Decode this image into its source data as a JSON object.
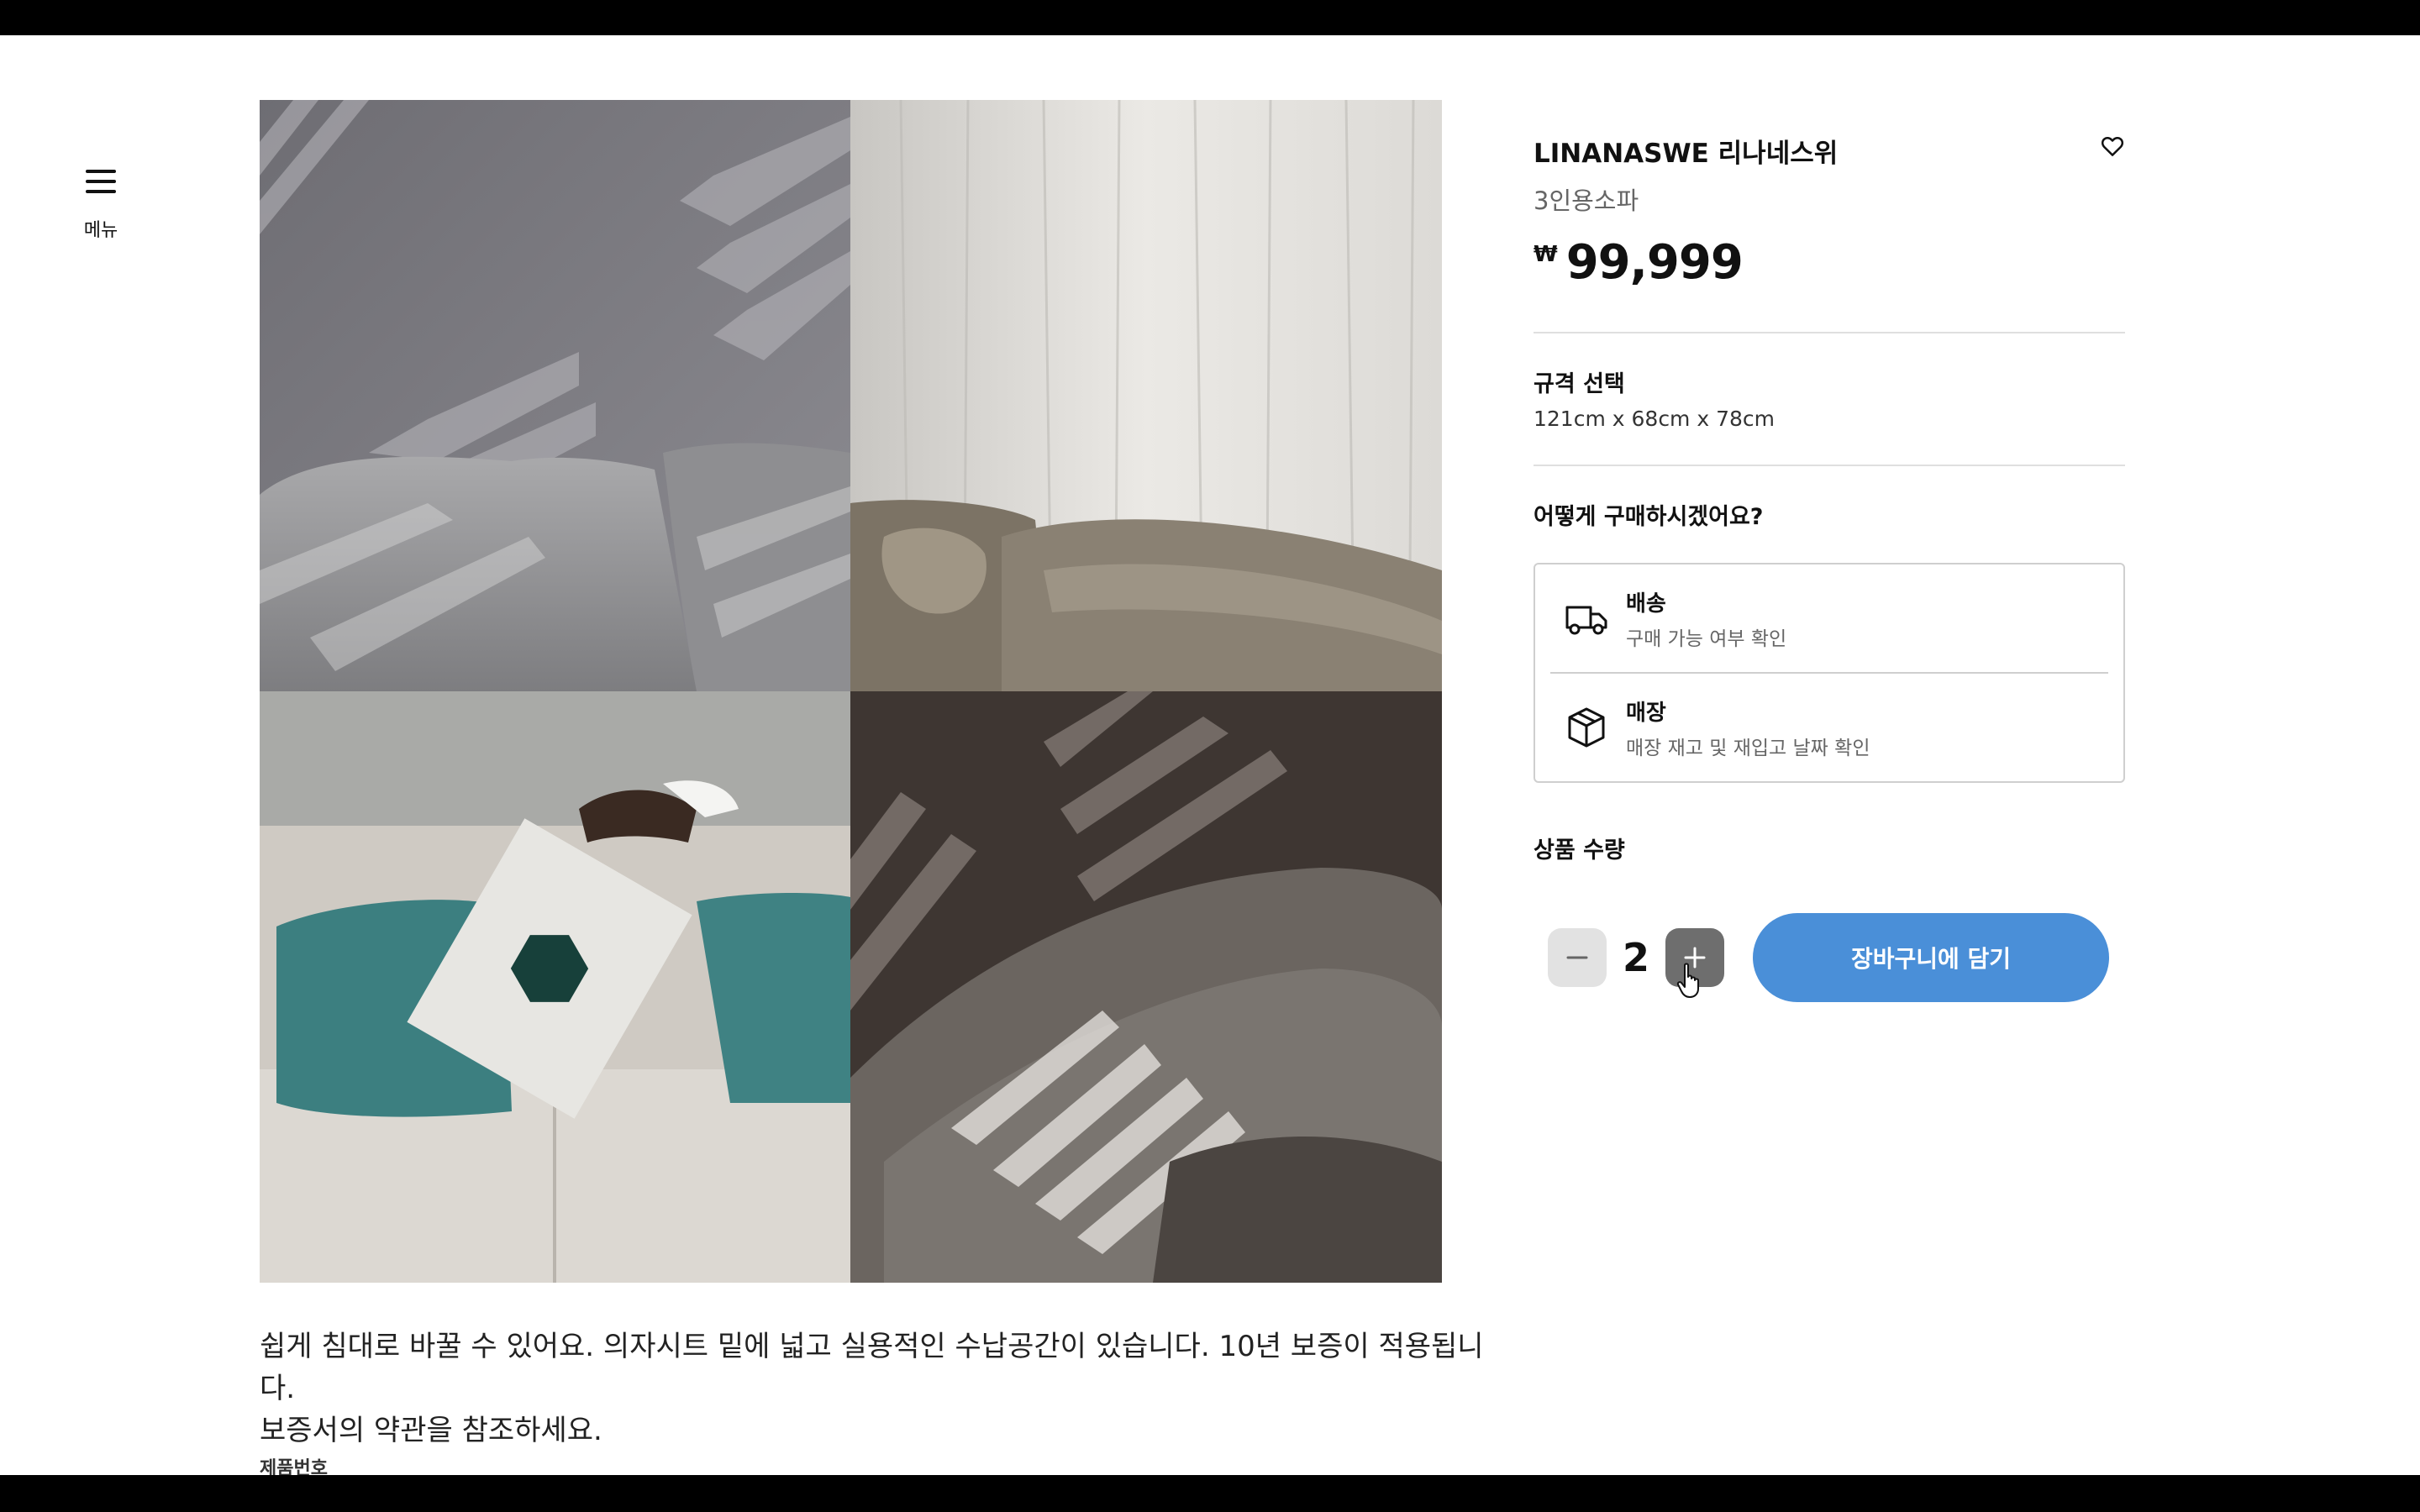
{
  "menu": {
    "label": "메뉴",
    "icon": "hamburger-icon"
  },
  "gallery": {
    "images": [
      {
        "alt": "sofa-shadow-gray",
        "icon": "image"
      },
      {
        "alt": "sofa-curtain-beige",
        "icon": "image"
      },
      {
        "alt": "sofa-teal-pillows",
        "icon": "image"
      },
      {
        "alt": "sofa-dark-shadow",
        "icon": "image"
      }
    ]
  },
  "product": {
    "title": "LINANASWE 리나네스위",
    "subtitle": "3인용소파",
    "currency": "₩",
    "price": "99,999"
  },
  "spec": {
    "title": "규격 선택",
    "value": "121cm x 68cm x 78cm"
  },
  "purchase": {
    "title": "어떻게 구매하시겠어요?",
    "options": [
      {
        "title": "배송",
        "subtitle": "구매 가능 여부 확인",
        "icon": "truck-icon"
      },
      {
        "title": "매장",
        "subtitle": "매장 재고 및 재입고 날짜 확인",
        "icon": "box-icon"
      }
    ]
  },
  "quantity": {
    "title": "상품 수량",
    "value": "2"
  },
  "cart": {
    "label": "장바구니에 담기"
  },
  "description": {
    "line1": "쉽게 침대로 바꿀 수 있어요. 의자시트 밑에 넓고 실용적인 수납공간이 있습니다. 10년 보증이 적용됩니다.",
    "line2": "보증서의 약관을 참조하세요."
  },
  "product_number_label": "제품번호",
  "colors": {
    "accent": "#4a8fd8",
    "divider": "#dfdfdf"
  }
}
